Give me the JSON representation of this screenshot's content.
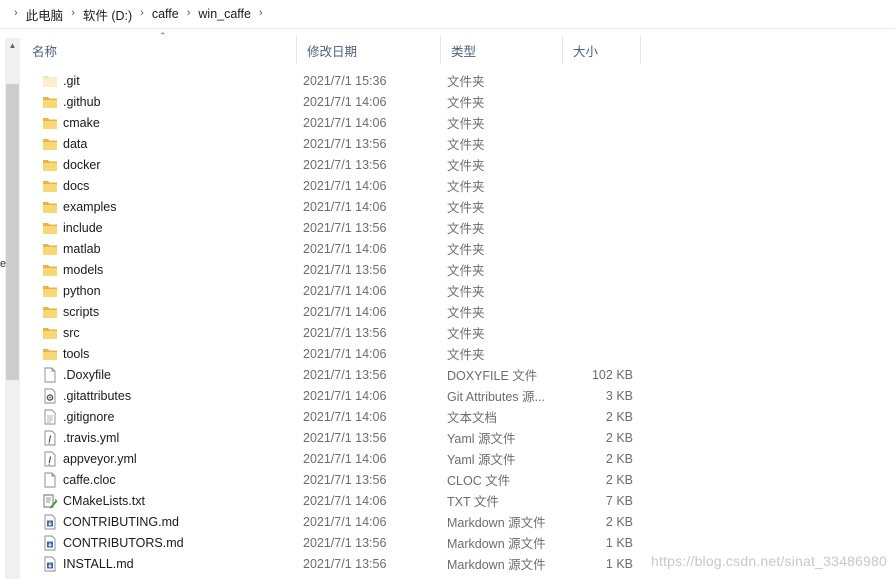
{
  "breadcrumb": [
    "此电脑",
    "软件 (D:)",
    "caffe",
    "win_caffe"
  ],
  "columns": {
    "name": "名称",
    "date": "修改日期",
    "type": "类型",
    "size": "大小"
  },
  "left_clip_char": "e",
  "watermark": "https://blog.csdn.net/sinat_33486980",
  "files": [
    {
      "name": ".git",
      "date": "2021/7/1 15:36",
      "type": "文件夹",
      "size": "",
      "icon": "folder-faded-icon"
    },
    {
      "name": ".github",
      "date": "2021/7/1 14:06",
      "type": "文件夹",
      "size": "",
      "icon": "folder-icon"
    },
    {
      "name": "cmake",
      "date": "2021/7/1 14:06",
      "type": "文件夹",
      "size": "",
      "icon": "folder-icon"
    },
    {
      "name": "data",
      "date": "2021/7/1 13:56",
      "type": "文件夹",
      "size": "",
      "icon": "folder-icon"
    },
    {
      "name": "docker",
      "date": "2021/7/1 13:56",
      "type": "文件夹",
      "size": "",
      "icon": "folder-icon"
    },
    {
      "name": "docs",
      "date": "2021/7/1 14:06",
      "type": "文件夹",
      "size": "",
      "icon": "folder-icon"
    },
    {
      "name": "examples",
      "date": "2021/7/1 14:06",
      "type": "文件夹",
      "size": "",
      "icon": "folder-icon"
    },
    {
      "name": "include",
      "date": "2021/7/1 13:56",
      "type": "文件夹",
      "size": "",
      "icon": "folder-icon"
    },
    {
      "name": "matlab",
      "date": "2021/7/1 14:06",
      "type": "文件夹",
      "size": "",
      "icon": "folder-icon"
    },
    {
      "name": "models",
      "date": "2021/7/1 13:56",
      "type": "文件夹",
      "size": "",
      "icon": "folder-icon"
    },
    {
      "name": "python",
      "date": "2021/7/1 14:06",
      "type": "文件夹",
      "size": "",
      "icon": "folder-icon"
    },
    {
      "name": "scripts",
      "date": "2021/7/1 14:06",
      "type": "文件夹",
      "size": "",
      "icon": "folder-icon"
    },
    {
      "name": "src",
      "date": "2021/7/1 13:56",
      "type": "文件夹",
      "size": "",
      "icon": "folder-icon"
    },
    {
      "name": "tools",
      "date": "2021/7/1 14:06",
      "type": "文件夹",
      "size": "",
      "icon": "folder-icon"
    },
    {
      "name": ".Doxyfile",
      "date": "2021/7/1 13:56",
      "type": "DOXYFILE 文件",
      "size": "102 KB",
      "icon": "file-icon"
    },
    {
      "name": ".gitattributes",
      "date": "2021/7/1 14:06",
      "type": "Git Attributes 源...",
      "size": "3 KB",
      "icon": "settings-file-icon"
    },
    {
      "name": ".gitignore",
      "date": "2021/7/1 14:06",
      "type": "文本文档",
      "size": "2 KB",
      "icon": "text-file-icon"
    },
    {
      "name": ".travis.yml",
      "date": "2021/7/1 13:56",
      "type": "Yaml 源文件",
      "size": "2 KB",
      "icon": "yaml-file-icon"
    },
    {
      "name": "appveyor.yml",
      "date": "2021/7/1 14:06",
      "type": "Yaml 源文件",
      "size": "2 KB",
      "icon": "yaml-file-icon"
    },
    {
      "name": "caffe.cloc",
      "date": "2021/7/1 13:56",
      "type": "CLOC 文件",
      "size": "2 KB",
      "icon": "file-icon"
    },
    {
      "name": "CMakeLists.txt",
      "date": "2021/7/1 14:06",
      "type": "TXT 文件",
      "size": "7 KB",
      "icon": "txt-edit-icon"
    },
    {
      "name": "CONTRIBUTING.md",
      "date": "2021/7/1 14:06",
      "type": "Markdown 源文件",
      "size": "2 KB",
      "icon": "markdown-file-icon"
    },
    {
      "name": "CONTRIBUTORS.md",
      "date": "2021/7/1 13:56",
      "type": "Markdown 源文件",
      "size": "1 KB",
      "icon": "markdown-file-icon"
    },
    {
      "name": "INSTALL.md",
      "date": "2021/7/1 13:56",
      "type": "Markdown 源文件",
      "size": "1 KB",
      "icon": "markdown-file-icon"
    }
  ]
}
